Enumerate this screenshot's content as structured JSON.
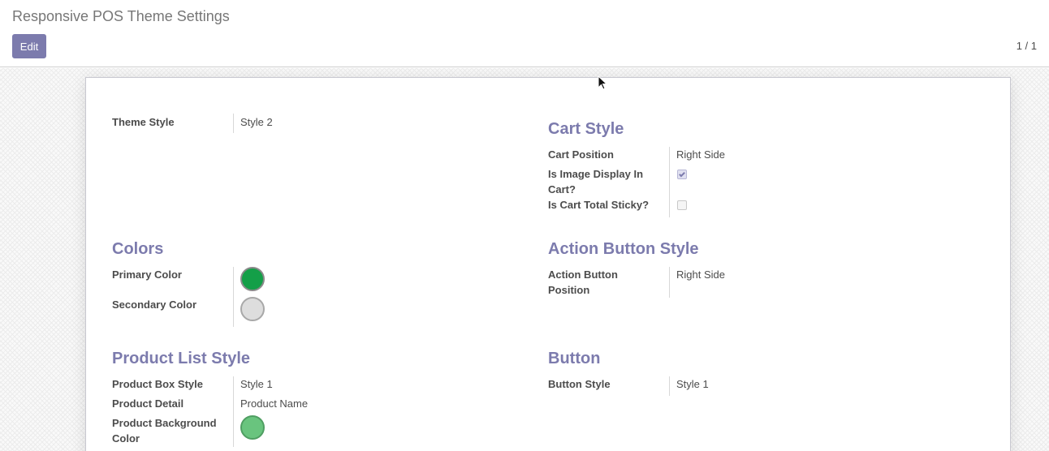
{
  "header": {
    "breadcrumb": "Responsive POS Theme Settings",
    "edit_label": "Edit",
    "pager": "1 / 1"
  },
  "form": {
    "theme_style": {
      "label": "Theme Style",
      "value": "Style 2"
    },
    "cart_style": {
      "title": "Cart Style",
      "cart_position": {
        "label": "Cart Position",
        "value": "Right Side"
      },
      "image_display": {
        "label_line1": "Is Image Display In",
        "label_line2": "Cart?",
        "checked": true
      },
      "total_sticky": {
        "label": "Is Cart Total Sticky?",
        "checked": false
      }
    },
    "colors": {
      "title": "Colors",
      "primary": {
        "label": "Primary Color",
        "color": "#149f48"
      },
      "secondary": {
        "label": "Secondary Color",
        "color": "#dddddd"
      }
    },
    "action_button_style": {
      "title": "Action Button Style",
      "position": {
        "label_line1": "Action Button",
        "label_line2": "Position",
        "value": "Right Side"
      }
    },
    "product_list_style": {
      "title": "Product List Style",
      "box_style": {
        "label": "Product Box Style",
        "value": "Style 1"
      },
      "detail": {
        "label": "Product Detail",
        "value": "Product Name"
      },
      "background": {
        "label_line1": "Product Background",
        "label_line2": "Color",
        "color": "#69c47e"
      }
    },
    "button": {
      "title": "Button",
      "style": {
        "label": "Button Style",
        "value": "Style 1"
      }
    }
  },
  "colors": {
    "accent": "#7c7bad"
  }
}
